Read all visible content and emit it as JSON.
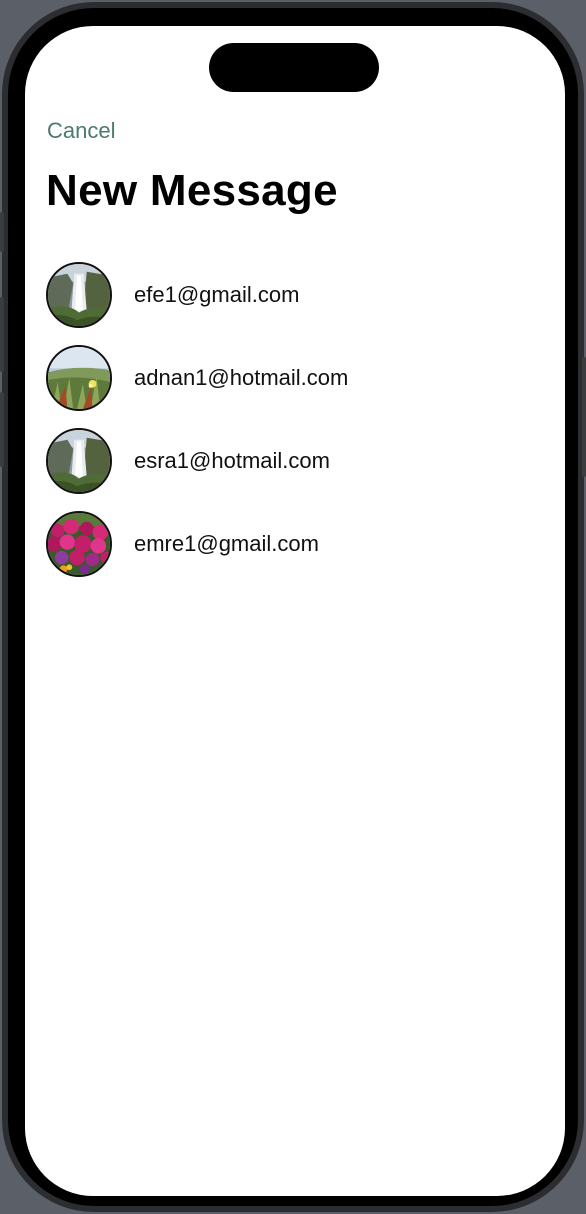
{
  "header": {
    "cancel_label": "Cancel",
    "title": "New Message"
  },
  "contacts": [
    {
      "email": "efe1@gmail.com",
      "avatar": "waterfall-photo"
    },
    {
      "email": "adnan1@hotmail.com",
      "avatar": "meadow-photo"
    },
    {
      "email": "esra1@hotmail.com",
      "avatar": "waterfall-photo"
    },
    {
      "email": "emre1@gmail.com",
      "avatar": "flowers-photo"
    }
  ],
  "colors": {
    "accent": "#4b7b6b",
    "background": "#ffffff",
    "text": "#111111"
  }
}
